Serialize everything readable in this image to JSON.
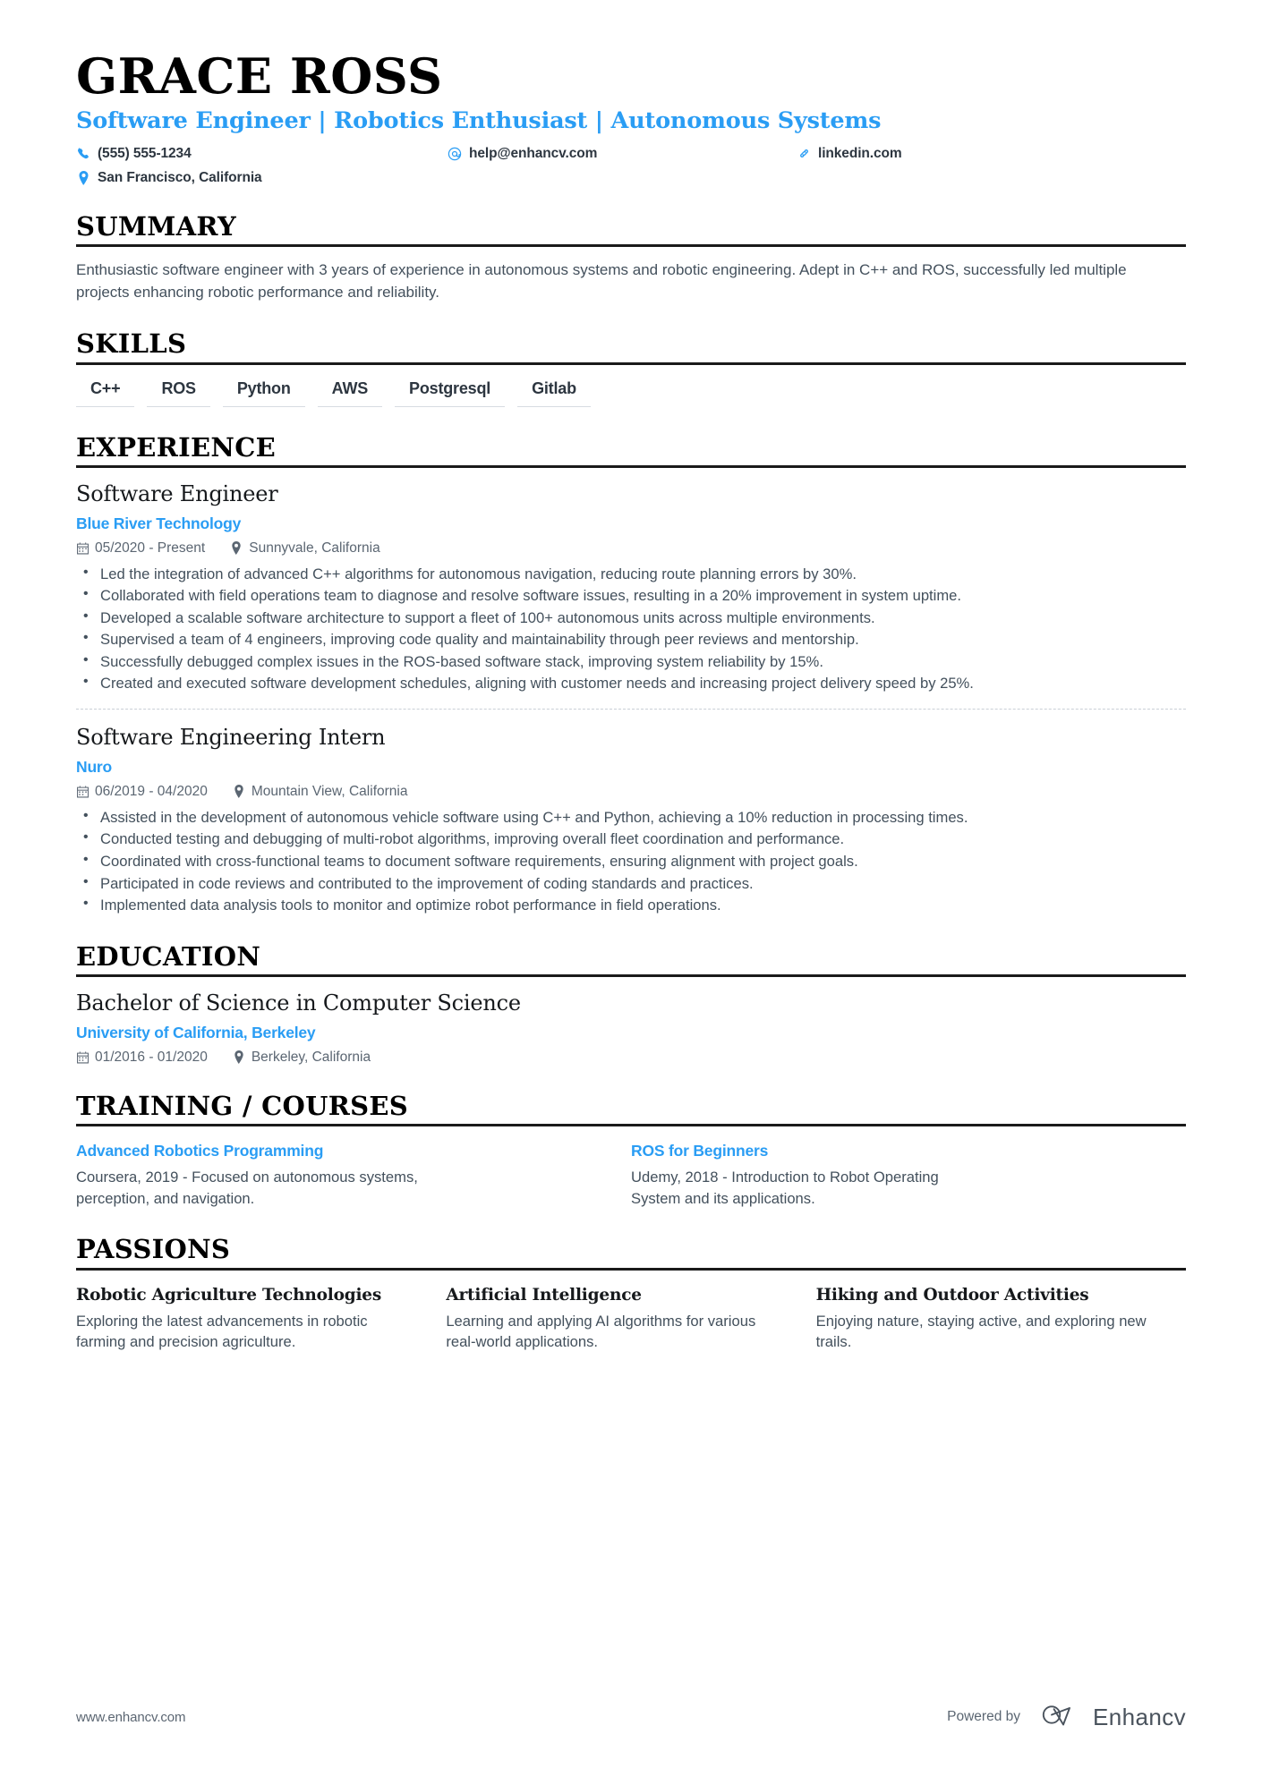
{
  "theme": {
    "accent": "#2a9df4",
    "heading": "#000000",
    "body": "#43505c",
    "muted": "#5b6672",
    "rule": "#1a1a1a"
  },
  "header": {
    "name": "GRACE ROSS",
    "headline": "Software Engineer | Robotics Enthusiast | Autonomous Systems",
    "contacts": [
      {
        "icon": "phone-icon",
        "text": "(555) 555-1234"
      },
      {
        "icon": "email-icon",
        "text": "help@enhancv.com"
      },
      {
        "icon": "link-icon",
        "text": "linkedin.com"
      },
      {
        "icon": "location-icon",
        "text": "San Francisco, California"
      }
    ]
  },
  "sections": {
    "summary": {
      "heading": "SUMMARY",
      "text": "Enthusiastic software engineer with 3 years of experience in autonomous systems and robotic engineering. Adept in C++ and ROS, successfully led multiple projects enhancing robotic performance and reliability."
    },
    "skills": {
      "heading": "SKILLS",
      "items": [
        "C++",
        "ROS",
        "Python",
        "AWS",
        "Postgresql",
        "Gitlab"
      ]
    },
    "experience": {
      "heading": "EXPERIENCE",
      "entries": [
        {
          "title": "Software Engineer",
          "org": "Blue River Technology",
          "dates": "05/2020 - Present",
          "location": "Sunnyvale, California",
          "bullets": [
            "Led the integration of advanced C++ algorithms for autonomous navigation, reducing route planning errors by 30%.",
            "Collaborated with field operations team to diagnose and resolve software issues, resulting in a 20% improvement in system uptime.",
            "Developed a scalable software architecture to support a fleet of 100+ autonomous units across multiple environments.",
            "Supervised a team of 4 engineers, improving code quality and maintainability through peer reviews and mentorship.",
            "Successfully debugged complex issues in the ROS-based software stack, improving system reliability by 15%.",
            "Created and executed software development schedules, aligning with customer needs and increasing project delivery speed by 25%."
          ]
        },
        {
          "title": "Software Engineering Intern",
          "org": "Nuro",
          "dates": "06/2019 - 04/2020",
          "location": "Mountain View, California",
          "bullets": [
            "Assisted in the development of autonomous vehicle software using C++ and Python, achieving a 10% reduction in processing times.",
            "Conducted testing and debugging of multi-robot algorithms, improving overall fleet coordination and performance.",
            "Coordinated with cross-functional teams to document software requirements, ensuring alignment with project goals.",
            "Participated in code reviews and contributed to the improvement of coding standards and practices.",
            "Implemented data analysis tools to monitor and optimize robot performance in field operations."
          ]
        }
      ]
    },
    "education": {
      "heading": "EDUCATION",
      "entries": [
        {
          "title": "Bachelor of Science in Computer Science",
          "org": "University of California, Berkeley",
          "dates": "01/2016 - 01/2020",
          "location": "Berkeley, California"
        }
      ]
    },
    "training": {
      "heading": "TRAINING / COURSES",
      "items": [
        {
          "title": "Advanced Robotics Programming",
          "desc": "Coursera, 2019 - Focused on autonomous systems, perception, and navigation."
        },
        {
          "title": "ROS for Beginners",
          "desc": "Udemy, 2018 - Introduction to Robot Operating System and its applications."
        }
      ]
    },
    "passions": {
      "heading": "PASSIONS",
      "items": [
        {
          "title": "Robotic Agriculture Technologies",
          "desc": "Exploring the latest advancements in robotic farming and precision agriculture."
        },
        {
          "title": "Artificial Intelligence",
          "desc": "Learning and applying AI algorithms for various real-world applications."
        },
        {
          "title": "Hiking and Outdoor Activities",
          "desc": "Enjoying nature, staying active, and exploring new trails."
        }
      ]
    }
  },
  "footer": {
    "url": "www.enhancv.com",
    "powered_by": "Powered by",
    "brand": "Enhancv"
  }
}
